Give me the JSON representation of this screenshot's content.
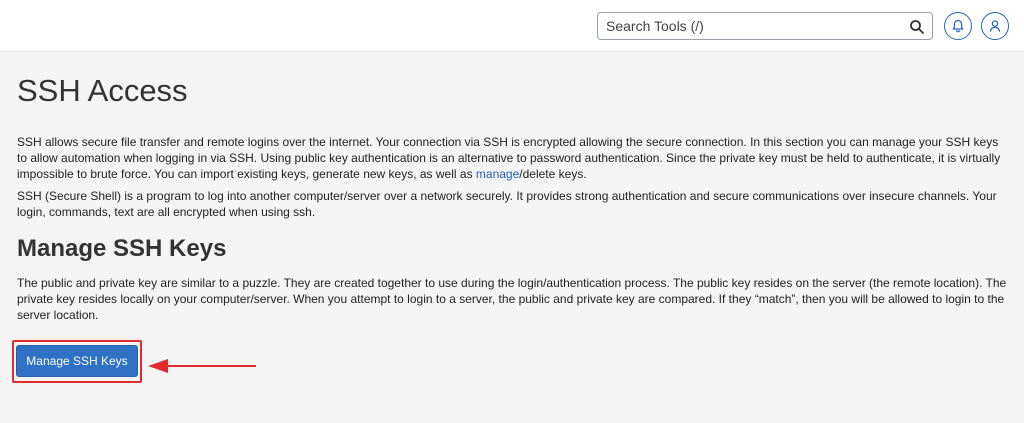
{
  "header": {
    "search": {
      "placeholder": "Search Tools (/)",
      "value": ""
    },
    "icons": [
      "search-icon",
      "bell-icon",
      "user-icon"
    ]
  },
  "main": {
    "title": "SSH Access",
    "intro": {
      "part1": "SSH allows secure file transfer and remote logins over the internet. Your connection via SSH is encrypted allowing the secure connection. In this section you can manage your SSH keys to allow automation when logging in via SSH. Using public key authentication is an alternative to password authentication. Since the private key must be held to authenticate, it is virtually impossible to brute force. You can import existing keys, generate new keys, as well as ",
      "link": "manage",
      "part2": "/delete keys."
    },
    "description": "SSH (Secure Shell) is a program to log into another computer/server over a network securely. It provides strong authentication and secure communications over insecure channels. Your login, commands, text are all encrypted when using ssh.",
    "section_title": "Manage SSH Keys",
    "section_text": "The public and private key are similar to a puzzle. They are created together to use during the login/authentication process. The public key resides on the server (the remote location). The private key resides locally on your computer/server. When you attempt to login to a server, the public and private key are compared. If they “match”, then you will be allowed to login to the server location.",
    "button_label": "Manage SSH Keys"
  },
  "colors": {
    "accent": "#2f71c4",
    "link": "#1f5fb4",
    "highlight": "#e02c2c",
    "background": "#f4f4f4"
  }
}
